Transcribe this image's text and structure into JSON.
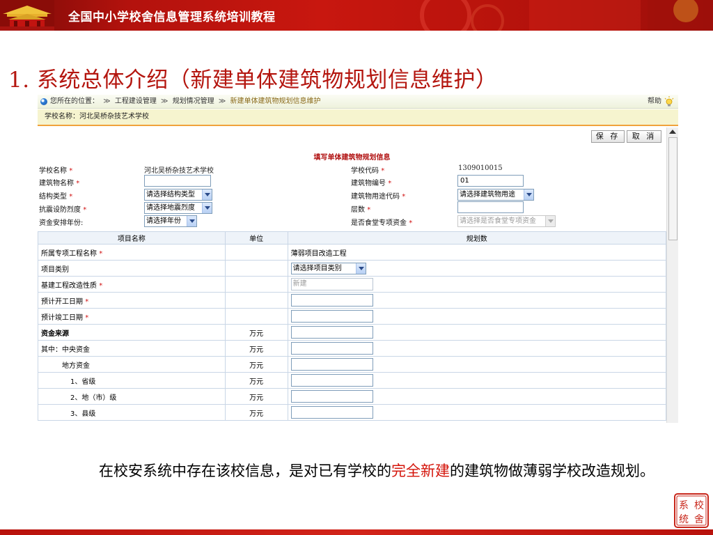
{
  "banner": {
    "title": "全国中小学校舍信息管理系统培训教程"
  },
  "slide": {
    "title": "1. 系统总体介绍（新建单体建筑物规划信息维护）"
  },
  "breadcrumb": {
    "prefix": "您所在的位置：",
    "sep": "≫",
    "items": [
      "工程建设管理",
      "规划情况管理",
      "新建单体建筑物规划信息维护"
    ],
    "help": "帮助"
  },
  "school_bar": {
    "text": "学校名称：河北吴桥杂技艺术学校"
  },
  "buttons": {
    "save": "保 存",
    "cancel": "取 消"
  },
  "form": {
    "title": "填写单体建筑物规划信息",
    "school_name_label": "学校名称",
    "school_name_value": "河北吴桥杂技艺术学校",
    "school_code_label": "学校代码",
    "school_code_value": "1309010015",
    "building_name_label": "建筑物名称",
    "building_name_value": "",
    "building_no_label": "建筑物编号",
    "building_no_value": "01",
    "structure_label": "结构类型",
    "structure_value": "请选择结构类型",
    "usage_label": "建筑物用途代码",
    "usage_value": "请选择建筑物用途",
    "seismic_label": "抗震设防烈度",
    "seismic_value": "请选择地震烈度",
    "floors_label": "层数",
    "floors_value": "",
    "fund_year_label": "资金安排年份:",
    "fund_year_value": "请选择年份",
    "canteen_label": "是否食堂专项资金",
    "canteen_value": "请选择是否食堂专项资金",
    "required_mark": "*"
  },
  "table": {
    "headers": [
      "项目名称",
      "单位",
      "规划数"
    ],
    "rows": [
      {
        "name": "所属专项工程名称",
        "required": "*",
        "unit": "",
        "value": "薄弱项目改造工程",
        "kind": "text"
      },
      {
        "name": "项目类别",
        "required": "",
        "unit": "",
        "value": "请选择项目类别",
        "kind": "select"
      },
      {
        "name": "基建工程改造性质",
        "required": "*",
        "unit": "",
        "value": "新建",
        "kind": "input-disabled"
      },
      {
        "name": "预计开工日期",
        "required": "*",
        "unit": "",
        "value": "",
        "kind": "input"
      },
      {
        "name": "预计竣工日期",
        "required": "*",
        "unit": "",
        "value": "",
        "kind": "input"
      },
      {
        "name": "资金来源",
        "required": "",
        "unit": "万元",
        "value": "",
        "kind": "input"
      },
      {
        "name": "其中：中央资金",
        "required": "",
        "unit": "万元",
        "value": "",
        "kind": "input"
      },
      {
        "name": "地方资金",
        "required": "",
        "unit": "万元",
        "value": "",
        "kind": "input"
      },
      {
        "name": "1、省级",
        "required": "",
        "unit": "万元",
        "value": "",
        "kind": "input"
      },
      {
        "name": "2、地（市）级",
        "required": "",
        "unit": "万元",
        "value": "",
        "kind": "input"
      },
      {
        "name": "3、县级",
        "required": "",
        "unit": "万元",
        "value": "",
        "kind": "input"
      }
    ]
  },
  "caption": {
    "part1": "在校安系统中存在该校信息，是对已有学校的",
    "highlight": "完全新建",
    "part2": "的建筑物做薄弱学校改造规划。"
  },
  "stamp": {
    "text": "系校统舍"
  },
  "colors": {
    "brand_red": "#b4160f",
    "highlight_red": "#d4140a",
    "required_red": "#d01010"
  }
}
